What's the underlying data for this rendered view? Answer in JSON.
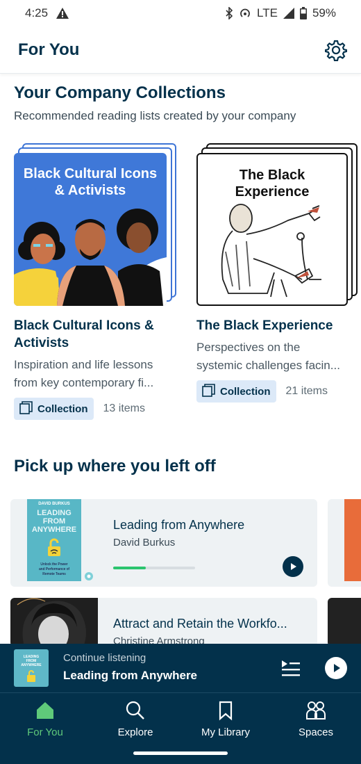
{
  "status_bar": {
    "time": "4:25",
    "network": "LTE",
    "battery": "59%"
  },
  "header": {
    "title": "For You",
    "settings_icon": "gear-icon"
  },
  "collections_section": {
    "title": "Your Company Collections",
    "subtitle": "Recommended reading lists created by your company",
    "items": [
      {
        "cover_text_line1": "Black Cultural Icons",
        "cover_text_line2": "& Activists",
        "title_line1": "Black Cultural Icons &",
        "title_line2": "Activists",
        "desc_line1": "Inspiration and life lessons",
        "desc_line2": "from key contemporary fi...",
        "badge": "Collection",
        "count": "13 items",
        "accent": "#3f78d8"
      },
      {
        "cover_text_line1": "The Black",
        "cover_text_line2": "Experience",
        "title_line1": "The Black Experience",
        "desc_line1": "Perspectives on the",
        "desc_line2": "systemic challenges facin...",
        "badge": "Collection",
        "count": "21 items",
        "accent": "#111111"
      }
    ]
  },
  "continue_section": {
    "title": "Pick up where you left off",
    "cards": [
      {
        "cover_author": "DAVID BURKUS",
        "cover_title_line1": "LEADING",
        "cover_title_line2": "FROM",
        "cover_title_line3": "ANYWHERE",
        "cover_tagline_line1": "Unlock the Power",
        "cover_tagline_line2": "and Performance of",
        "cover_tagline_line3": "Remote Teams",
        "title": "Leading from Anywhere",
        "author": "David Burkus",
        "progress": 0.4
      },
      {
        "title": "Attract and Retain the Workfo...",
        "author": "Christine Armstrong"
      }
    ]
  },
  "mini_player": {
    "label": "Continue listening",
    "title": "Leading from Anywhere",
    "cover_title_line1": "LEADING",
    "cover_title_line2": "FROM",
    "cover_title_line3": "ANYWHERE"
  },
  "bottom_nav": {
    "items": [
      {
        "label": "For You",
        "icon": "home-icon",
        "active": true
      },
      {
        "label": "Explore",
        "icon": "search-icon",
        "active": false
      },
      {
        "label": "My Library",
        "icon": "bookmark-icon",
        "active": false
      },
      {
        "label": "Spaces",
        "icon": "people-icon",
        "active": false
      }
    ],
    "active_color": "#5fc97a"
  },
  "colors": {
    "navy": "#03314b",
    "accent_green": "#2bc46e",
    "badge_bg": "#dce9f8"
  }
}
